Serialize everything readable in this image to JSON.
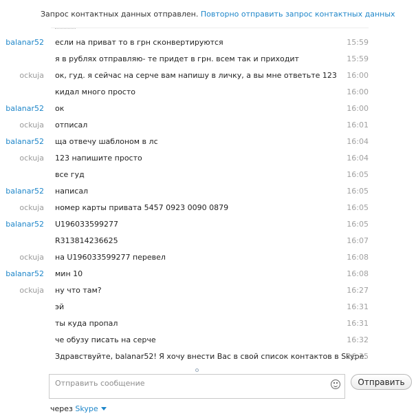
{
  "banner": {
    "status_text": "Запрос контактных данных отправлен.",
    "resend_link": "Повторно отправить запрос контактных данных"
  },
  "messages": [
    {
      "sender": "balanar52",
      "me": true,
      "text": "если на приват то в грн сконвертируются",
      "time": "15:59"
    },
    {
      "sender": "",
      "me": true,
      "text": "я в рублях отправляю- те придет в грн. всем так и приходит",
      "time": "15:59"
    },
    {
      "sender": "ockuja",
      "me": false,
      "text": "ок, гуд. я сейчас на серче вам напишу в личку, а вы мне ответьте 123",
      "time": "16:00"
    },
    {
      "sender": "",
      "me": false,
      "text": "кидал много просто",
      "time": "16:00"
    },
    {
      "sender": "balanar52",
      "me": true,
      "text": "ок",
      "time": "16:00"
    },
    {
      "sender": "ockuja",
      "me": false,
      "text": "отписал",
      "time": "16:01"
    },
    {
      "sender": "balanar52",
      "me": true,
      "text": "ща отвечу шаблоном в лс",
      "time": "16:04"
    },
    {
      "sender": "ockuja",
      "me": false,
      "text": "123 напишите просто",
      "time": "16:04"
    },
    {
      "sender": "",
      "me": false,
      "text": "все гуд",
      "time": "16:05"
    },
    {
      "sender": "balanar52",
      "me": true,
      "text": "написал",
      "time": "16:05"
    },
    {
      "sender": "ockuja",
      "me": false,
      "text": "номер карты привата 5457 0923 0090 0879",
      "time": "16:05"
    },
    {
      "sender": "balanar52",
      "me": true,
      "text": "U196033599277",
      "time": "16:05"
    },
    {
      "sender": "",
      "me": true,
      "text": "R313814236625",
      "time": "16:07"
    },
    {
      "sender": "ockuja",
      "me": false,
      "text": "на U196033599277 перевел",
      "time": "16:08"
    },
    {
      "sender": "balanar52",
      "me": true,
      "text": "мин 10",
      "time": "16:08"
    },
    {
      "sender": "ockuja",
      "me": false,
      "text": "ну что там?",
      "time": "16:27"
    },
    {
      "sender": "",
      "me": false,
      "text": "эй",
      "time": "16:31"
    },
    {
      "sender": "",
      "me": false,
      "text": "ты куда пропал",
      "time": "16:31"
    },
    {
      "sender": "",
      "me": false,
      "text": "че обузу писать на серче",
      "time": "16:32"
    },
    {
      "sender": "",
      "me": false,
      "text": "Здравствуйте, balanar52! Я хочу внести Вас в свой список контактов в Skype.",
      "time": "16:35"
    }
  ],
  "composer": {
    "placeholder": "Отправить сообщение",
    "value": "",
    "emoji_icon": "smiley-icon"
  },
  "send_button": {
    "label": "Отправить"
  },
  "footer": {
    "via_label": "через",
    "network_label": "Skype",
    "caret_icon": "caret-down-icon"
  },
  "colors": {
    "link": "#1e86c9",
    "other_sender": "#9a9a9a",
    "timestamp": "#a0a0a0"
  }
}
